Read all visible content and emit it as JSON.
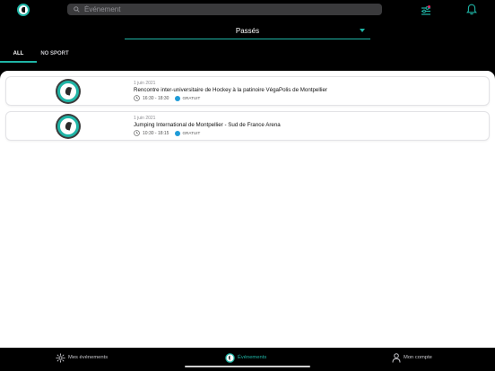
{
  "header": {
    "search_placeholder": "Événement",
    "accent_color": "#1fb5a6"
  },
  "period_selector": {
    "selected": "Passés"
  },
  "tabs": [
    {
      "label": "ALL",
      "active": true
    },
    {
      "label": "NO SPORT",
      "active": false
    }
  ],
  "events": [
    {
      "date": "1 juin 2021",
      "title": "Rencontre inter-universitaire de Hockey à la patinoire VégaPolis de Montpellier",
      "time": "16:30 - 18:30",
      "price": "GRATUIT"
    },
    {
      "date": "1 juin 2021",
      "title": "Jumping International de Montpellier - Sud de France Arena",
      "time": "10:30 - 18:15",
      "price": "GRATUIT"
    }
  ],
  "bottom_nav": {
    "mes_evenements": "Mes événements",
    "evenements": "Événements",
    "mon_compte": "Mon compte",
    "active": "Événements"
  }
}
